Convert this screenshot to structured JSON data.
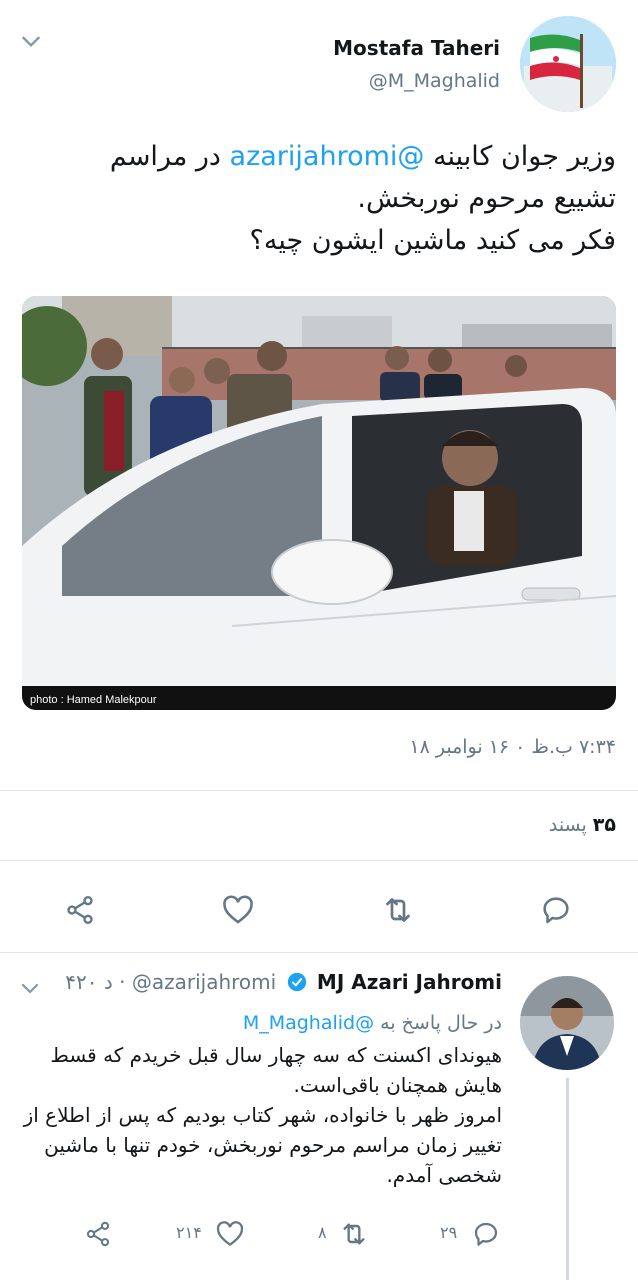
{
  "main_tweet": {
    "author_name": "Mostafa Taheri",
    "author_handle": "@M_Maghalid",
    "text_line1_prefix": "وزیر جوان کابینه",
    "text_mention": "@azarijahromi",
    "text_line1_suffix": "در مراسم",
    "text_line2": "تشییع مرحوم نوربخش.",
    "text_line3": "فکر می کنید ماشین ایشون چیه؟",
    "photo_credit": "photo : Hamed Malekpour",
    "timestamp": "۷:۳۴ ب.ظ ۰ ۱۶ نوامبر ۱۸",
    "likes_count": "۳۵",
    "likes_label": "پسند"
  },
  "reply_tweet": {
    "author_name": "MJ Azari Jahromi",
    "author_handle": "@azarijahromi",
    "time_ago": "۴۲۰ د",
    "replying_to_label": "در حال پاسخ به",
    "replying_to_handle": "@M_Maghalid",
    "text": "هیوندای اکسنت که سه چهار سال قبل خریدم که قسط هایش همچنان باقی‌است.\nامروز ظهر با خانواده، شهر کتاب بودیم که پس از اطلاع از تغییر زمان مراسم مرحوم نوربخش، خودم تنها با ماشین شخصی آمدم.",
    "reply_count": "۲۹",
    "retweet_count": "۸",
    "like_count": "۲۱۴"
  },
  "colors": {
    "accent": "#1da1f2",
    "muted": "#657786",
    "verified": "#1da1f2",
    "border": "#e1e8ed"
  },
  "icons": [
    "chevron-down-icon",
    "share-icon",
    "heart-icon",
    "retweet-icon",
    "reply-icon",
    "verified-icon"
  ]
}
